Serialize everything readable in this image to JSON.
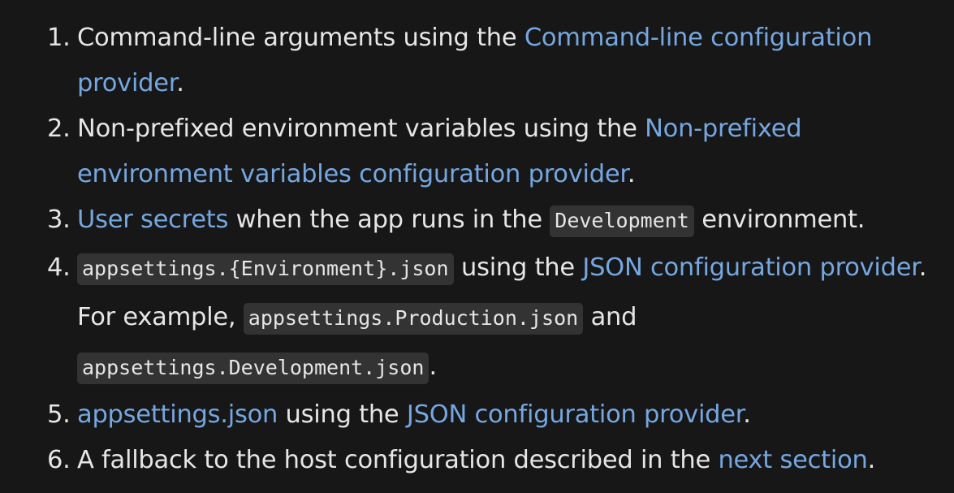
{
  "items": [
    {
      "number": "1.",
      "text1": "Command-line arguments using the ",
      "link1": "Command-line configuration provider",
      "text2": "."
    },
    {
      "number": "2.",
      "text1": "Non-prefixed environment variables using the ",
      "link1": "Non-prefixed environment variables configuration provider",
      "text2": "."
    },
    {
      "number": "3.",
      "link1": "User secrets",
      "text1": " when the app runs in the ",
      "code1": "Development",
      "text2": " environment."
    },
    {
      "number": "4.",
      "code1": "appsettings.{Environment}.json",
      "text1": " using the ",
      "link1": "JSON configuration provider",
      "text2": ". For example, ",
      "code2": "appsettings.Production.json",
      "text3": " and ",
      "code3": "appsettings.Development.json",
      "text4": "."
    },
    {
      "number": "5.",
      "link1": "appsettings.json",
      "text1": " using the ",
      "link2": "JSON configuration provider",
      "text2": "."
    },
    {
      "number": "6.",
      "text1": "A fallback to the host configuration described in the ",
      "link1": "next section",
      "text2": "."
    }
  ],
  "colors": {
    "background": "#171717",
    "text": "#e6e6e6",
    "link": "#75a7e1",
    "code_background": "#333333"
  }
}
